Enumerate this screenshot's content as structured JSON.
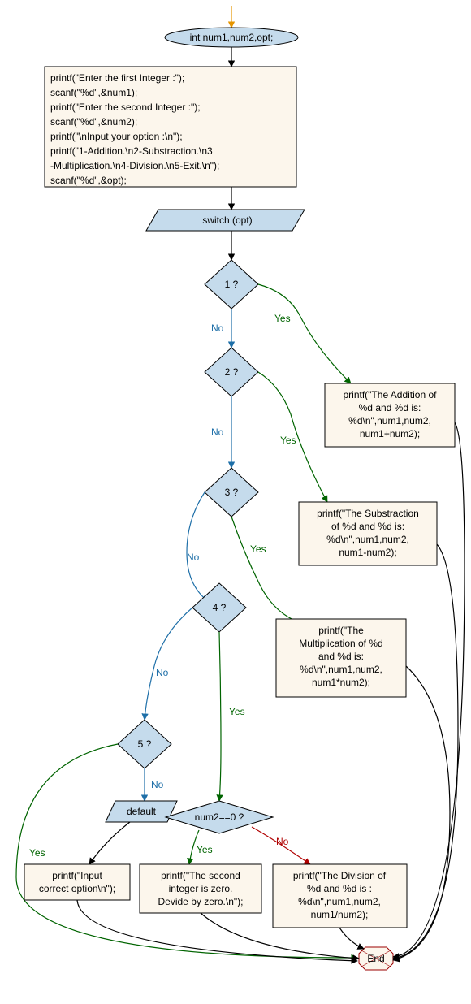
{
  "nodes": {
    "start": "int num1,num2,opt;",
    "io": {
      "l1": "printf(\"Enter the first Integer :\");",
      "l2": "scanf(\"%d\",&num1);",
      "l3": "printf(\"Enter the second Integer :\");",
      "l4": "scanf(\"%d\",&num2);",
      "l5": "printf(\"\\nInput your option :\\n\");",
      "l6": "printf(\"1-Addition.\\n2-Substraction.\\n3",
      "l7": "-Multiplication.\\n4-Division.\\n5-Exit.\\n\");",
      "l8": "scanf(\"%d\",&opt);"
    },
    "switch": "switch (opt)",
    "d1": "1 ?",
    "d2": "2 ?",
    "d3": "3 ?",
    "d4": "4 ?",
    "d5": "5 ?",
    "default": "default",
    "numzero": "num2==0 ?",
    "add": {
      "l1": "printf(\"The Addition of",
      "l2": " %d and %d is:",
      "l3": " %d\\n\",num1,num2,",
      "l4": "num1+num2);"
    },
    "sub": {
      "l1": "printf(\"The Substraction",
      "l2": " of %d  and %d is:",
      "l3": " %d\\n\",num1,num2,",
      "l4": "num1-num2);"
    },
    "mul": {
      "l1": "printf(\"The",
      "l2": " Multiplication of %d",
      "l3": " and %d is:",
      "l4": " %d\\n\",num1,num2,",
      "l5": "num1*num2);"
    },
    "divzero": {
      "l1": "printf(\"The second",
      "l2": " integer is zero.",
      "l3": " Devide by zero.\\n\");"
    },
    "div": {
      "l1": "printf(\"The Division of",
      "l2": " %d  and %d is :",
      "l3": " %d\\n\",num1,num2,",
      "l4": "num1/num2);"
    },
    "inputcorrect": {
      "l1": "printf(\"Input",
      "l2": " correct option\\n\");"
    },
    "end": "End"
  },
  "labels": {
    "yes": "Yes",
    "no": "No"
  }
}
